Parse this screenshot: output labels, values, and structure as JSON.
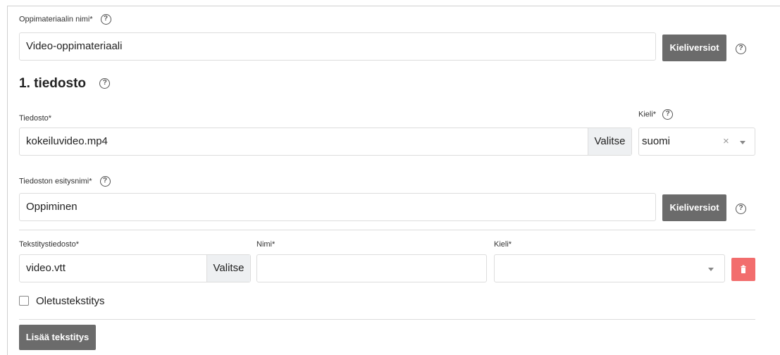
{
  "material": {
    "name_label": "Oppimateriaalin nimi*",
    "name_value": "Video-oppimateriaali",
    "language_versions_button": "Kieliversiot"
  },
  "file_section": {
    "heading": "1. tiedosto",
    "file_label": "Tiedosto*",
    "file_value": "kokeiluvideo.mp4",
    "choose_button": "Valitse",
    "language_label": "Kieli*",
    "language_value": "suomi",
    "clear_symbol": "×",
    "display_name_label": "Tiedoston esitysnimi*",
    "display_name_value": "Oppiminen",
    "language_versions_button": "Kieliversiot"
  },
  "subtitle": {
    "file_label": "Tekstitystiedosto*",
    "file_value": "video.vtt",
    "choose_button": "Valitse",
    "name_label": "Nimi*",
    "name_value": "",
    "language_label": "Kieli*",
    "language_value": "",
    "default_checkbox_label": "Oletustekstitys",
    "default_checked": false
  },
  "add_subtitle_button": "Lisää tekstitys",
  "help_glyph": "?",
  "colors": {
    "dark_button": "#6b6b6b",
    "delete_button": "#f26d6d",
    "addon_bg": "#eef0f2",
    "border": "#dddddd"
  }
}
